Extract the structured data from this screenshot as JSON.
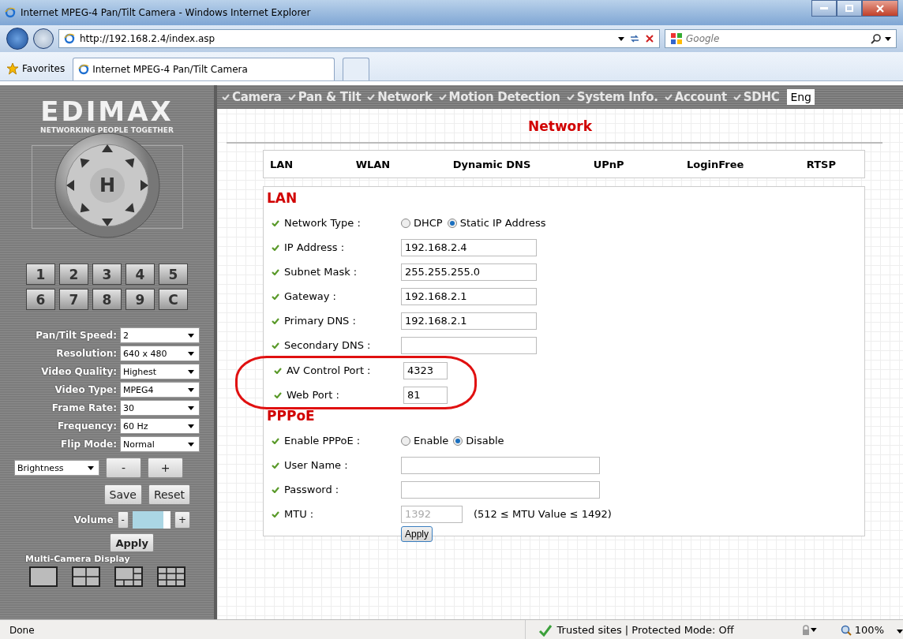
{
  "window": {
    "title": "Internet MPEG-4 Pan/Tilt Camera - Windows Internet Explorer"
  },
  "address_bar": {
    "url": "http://192.168.2.4/index.asp",
    "search_placeholder": "Google"
  },
  "favorites": {
    "label": "Favorites",
    "tabs": [
      {
        "label": "Internet MPEG-4 Pan/Tilt Camera",
        "selected": true
      }
    ]
  },
  "sidebar": {
    "logo": "EDIMAX",
    "tagline": "NETWORKING PEOPLE TOGETHER",
    "home_key": "H",
    "presets": [
      "1",
      "2",
      "3",
      "4",
      "5",
      "6",
      "7",
      "8",
      "9",
      "C"
    ],
    "settings": [
      {
        "label": "Pan/Tilt Speed:",
        "value": "2"
      },
      {
        "label": "Resolution:",
        "value": "640 x 480"
      },
      {
        "label": "Video Quality:",
        "value": "Highest"
      },
      {
        "label": "Video Type:",
        "value": "MPEG4"
      },
      {
        "label": "Frame Rate:",
        "value": "30"
      },
      {
        "label": "Frequency:",
        "value": "60 Hz"
      },
      {
        "label": "Flip Mode:",
        "value": "Normal"
      }
    ],
    "adjust": {
      "value": "Brightness",
      "minus": "-",
      "plus": "+"
    },
    "save": "Save",
    "reset": "Reset",
    "volume": {
      "label": "Volume",
      "minus": "-",
      "plus": "+",
      "level": 0.82
    },
    "apply": "Apply",
    "multi_camera_label": "Multi-Camera Display"
  },
  "nav": {
    "items": [
      "Camera",
      "Pan & Tilt",
      "Network",
      "Motion Detection",
      "System Info.",
      "Account",
      "SDHC"
    ],
    "language": "Eng"
  },
  "page_title": "Network",
  "subtabs": [
    "LAN",
    "WLAN",
    "Dynamic DNS",
    "UPnP",
    "LoginFree",
    "RTSP"
  ],
  "sections": [
    {
      "title": "LAN",
      "fields": [
        {
          "kind": "radio",
          "label": "Network Type :",
          "options": [
            {
              "label": "DHCP",
              "selected": false
            },
            {
              "label": "Static IP Address",
              "selected": true
            }
          ],
          "circled": false
        },
        {
          "kind": "text",
          "label": "IP Address :",
          "value": "192.168.2.4",
          "circled": false
        },
        {
          "kind": "text",
          "label": "Subnet Mask :",
          "value": "255.255.255.0",
          "circled": false
        },
        {
          "kind": "text",
          "label": "Gateway :",
          "value": "192.168.2.1",
          "circled": false
        },
        {
          "kind": "text",
          "label": "Primary DNS :",
          "value": "192.168.2.1",
          "circled": false
        },
        {
          "kind": "text",
          "label": "Secondary DNS :",
          "circled": false
        },
        {
          "kind": "port",
          "label": "AV Control Port :",
          "value": "4323",
          "circled": true
        },
        {
          "kind": "port",
          "label": "Web Port :",
          "value": "81",
          "circled": true
        }
      ]
    },
    {
      "title": "PPPoE",
      "fields": [
        {
          "kind": "radio",
          "label": "Enable PPPoE :",
          "options": [
            {
              "label": "Enable",
              "selected": false
            },
            {
              "label": "Disable",
              "selected": true
            }
          ],
          "circled": false
        },
        {
          "kind": "wide",
          "label": "User Name :",
          "circled": false
        },
        {
          "kind": "wide",
          "label": "Password :",
          "circled": false
        },
        {
          "kind": "mtu",
          "label": "MTU :",
          "value": "1392",
          "disabled": true,
          "note": "(512 ≤ MTU Value ≤ 1492)",
          "circled": false
        }
      ]
    }
  ],
  "apply": "Apply",
  "status_bar": {
    "status": "Done",
    "zone": "Trusted sites | Protected Mode: Off",
    "zoom": "100%"
  }
}
